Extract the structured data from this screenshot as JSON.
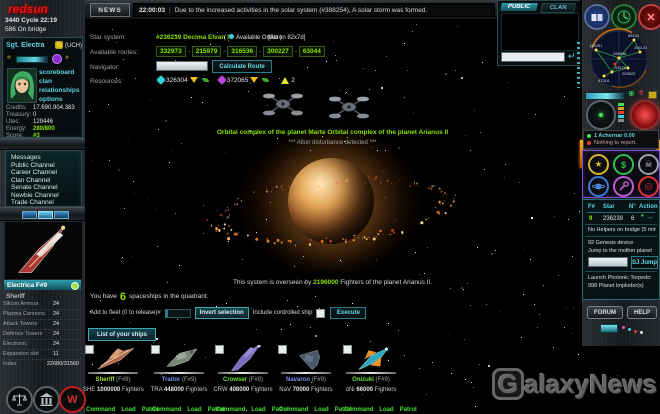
{
  "brand": {
    "logo": "redsun",
    "cycle": "3440 Cycle 22:19",
    "on_bridge": "586 On bridge"
  },
  "news": {
    "button": "NEWS",
    "time": "22:00:03",
    "text": "Due to the increased activities in the solar system (#388254), A solar storm was formed."
  },
  "player": {
    "name": "Sgt. Electra",
    "clan": "(UCH)",
    "links": [
      "scoreboard",
      "clan",
      "relationships",
      "options"
    ],
    "stats": [
      {
        "label": "Credits:",
        "value": "17.690.904.383"
      },
      {
        "label": "Treasury:",
        "value": "0"
      },
      {
        "label": "Utec:",
        "value": "129446"
      },
      {
        "label": "Energy:",
        "value": "280/800"
      },
      {
        "label": "Score:",
        "value": "#3"
      }
    ]
  },
  "channels": [
    "Messages",
    "Public Channel",
    "Career Channel",
    "Clan Channel",
    "Senate Channel",
    "Newbie Channel",
    "Trade Channel"
  ],
  "ship_panel": {
    "title": "Electrica F#9",
    "class": "Sheriff",
    "rows": [
      {
        "label": "Silicon Armour",
        "value": "24"
      },
      {
        "label": "Plasma Cannons",
        "value": "24"
      },
      {
        "label": "Attack Towers",
        "value": "24"
      },
      {
        "label": "Defence Towers",
        "value": "24"
      },
      {
        "label": "Electronic",
        "value": "24"
      },
      {
        "label": "Expansion slot",
        "value": "11"
      },
      {
        "label": "Index",
        "value": "22680/31560"
      }
    ]
  },
  "system": {
    "label": "Star system:",
    "value": "#236239 Decima Elvan IV",
    "orbits_open": "(",
    "orbits_label": "Available Orbits )",
    "aeron": "[Aeron 82x7d]",
    "routes_label": "Available routes:",
    "routes": [
      "332973",
      "215979",
      "316536",
      "300227",
      "63044"
    ],
    "navigator_label": "Navigator:",
    "calculate_button": "Calculate Route",
    "resources_label": "Resources:",
    "resource1": "326304",
    "resource2": "372065",
    "resource3": "2",
    "orbital_text": "Orbital complex of the planet Marte Orbital complex of the planet Arianus II",
    "disturbance": "*** Alton disturbance detected ***",
    "overseen_prefix": "This system is overseen by",
    "overseen_count": "2196000",
    "overseen_suffix": "Fighters of the planet Arianus II."
  },
  "fleet": {
    "you_have": "You have",
    "count": "6",
    "quadrant": "spaceships in the quadrant.",
    "add_label": "Add to fleet (0 to release)#",
    "invert_button": "Invert selection",
    "include_label": "Include controlled ship",
    "execute_button": "Execute",
    "list_button": "List of your ships"
  },
  "ships": [
    {
      "name": "Sheriff",
      "tag": "(F#9)",
      "abbr": "SHE",
      "count": "1000000",
      "unit": "Fighters",
      "color": "#aade3c",
      "links": [
        "Command",
        "Load",
        "Patrol"
      ]
    },
    {
      "name": "Traitor",
      "tag": "(F#9)",
      "abbr": "TRA",
      "count": "448000",
      "unit": "Fighters",
      "color": "#7d8fe8",
      "links": [
        "Command",
        "Load",
        "Patrol"
      ]
    },
    {
      "name": "Crowser",
      "tag": "(F#9)",
      "abbr": "CRW",
      "count": "408000",
      "unit": "Fighters",
      "color": "#6fe03c",
      "links": [
        "Command",
        "Load",
        "Patrol"
      ]
    },
    {
      "name": "Navaron",
      "tag": "(F#9)",
      "abbr": "NaV",
      "count": "70000",
      "unit": "Fighters",
      "color": "#7d8fe8",
      "links": [
        "Command",
        "Load",
        "Patrol"
      ]
    },
    {
      "name": "Onizuki",
      "tag": "(F#9)",
      "abbr": "oNi",
      "count": "66000",
      "unit": "Fighters",
      "color": "#6fe03c",
      "links": [
        "Command",
        "Load",
        "Patrol"
      ]
    }
  ],
  "chat": {
    "tabs": [
      "PUBLIC",
      "CLAN"
    ]
  },
  "right": {
    "radar_labels": [
      "130291",
      "88141",
      "205131",
      "268938",
      "93128",
      "209622",
      "47318"
    ],
    "status1": "1 Achernar 0.00",
    "status2": "Nothing to report.",
    "table": {
      "f": "F#",
      "star": "Star",
      "n": "N°",
      "action": "Action"
    },
    "row": {
      "f": "9",
      "star": "236239",
      "n": "6"
    },
    "helpers": "No Helpers on bridge (5 min...",
    "genesis1": "92 Genesis device",
    "genesis2": "Jump to the mother planet",
    "sj_jump": "SJ Jump",
    "torpedo1": "Launch Photonic Torpedo:",
    "torpedo2": "998 Planet Imploder(s)",
    "forum": "FORUM",
    "help": "HELP"
  },
  "watermark": {
    "g": "G",
    "rest": "alaxyNews"
  },
  "colors": {
    "accent": "#4dd0e1",
    "green": "#8ae300"
  }
}
